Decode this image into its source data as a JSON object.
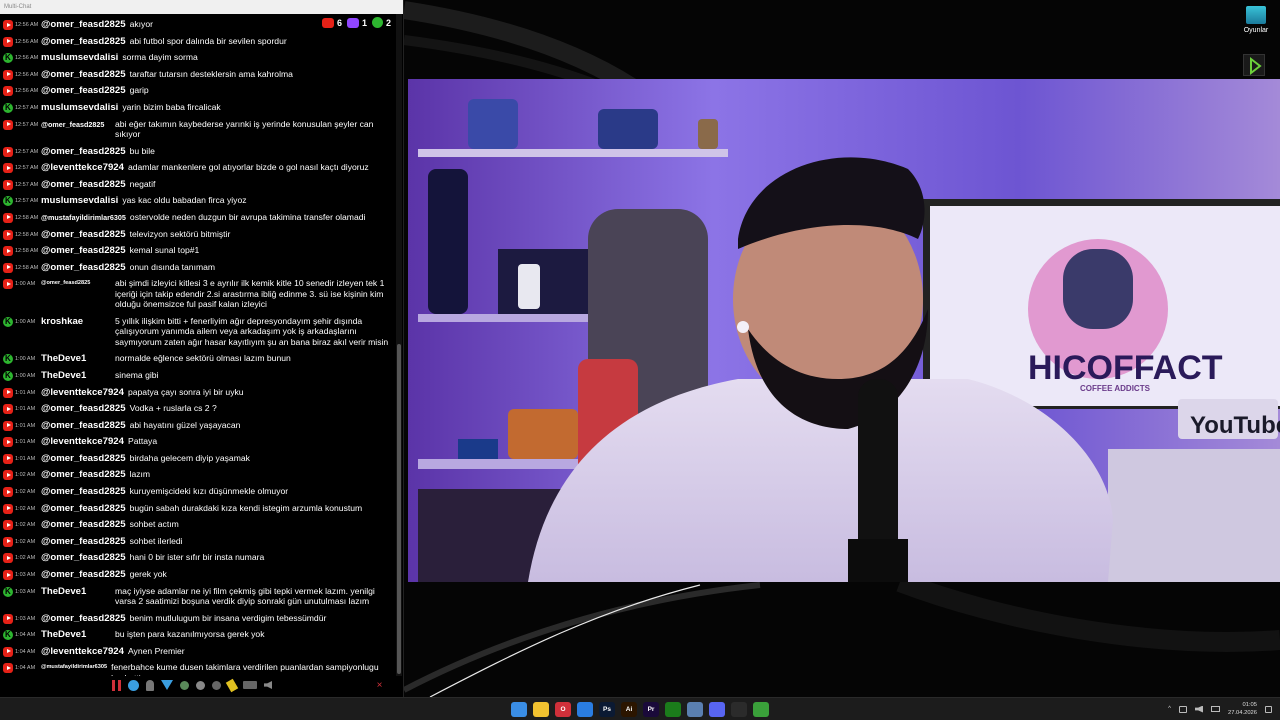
{
  "chat": {
    "title": "Multi-Chat",
    "counts": {
      "youtube": "6",
      "twitch": "1",
      "kick": "2"
    },
    "messages": [
      {
        "p": "yt",
        "time": "12:56 AM",
        "user": "@omer_feasd2825",
        "text": "akıyor"
      },
      {
        "p": "yt",
        "time": "12:56 AM",
        "user": "@omer_feasd2825",
        "text": "abi futbol spor dalında bir sevilen spordur"
      },
      {
        "p": "kk",
        "time": "12:56 AM",
        "user": "muslumsevdalisi",
        "text": "sorma dayim sorma"
      },
      {
        "p": "yt",
        "time": "12:56 AM",
        "user": "@omer_feasd2825",
        "text": "taraftar tutarsın desteklersin ama kahrolma"
      },
      {
        "p": "yt",
        "time": "12:56 AM",
        "user": "@omer_feasd2825",
        "text": "garip"
      },
      {
        "p": "kk",
        "time": "12:57 AM",
        "user": "muslumsevdalisi",
        "text": "yarin bizim baba fircalicak"
      },
      {
        "p": "yt",
        "time": "12:57 AM",
        "user": "@omer_feasd2825",
        "size": "sm",
        "fix": true,
        "text": "abi eğer takımın kaybederse yarınki iş yerinde konusulan şeyler can sıkıyor"
      },
      {
        "p": "yt",
        "time": "12:57 AM",
        "user": "@omer_feasd2825",
        "text": "bu bile"
      },
      {
        "p": "yt",
        "time": "12:57 AM",
        "user": "@leventtekce7924",
        "text": "adamlar mankenlere gol atıyorlar bizde o gol nasıl kaçtı diyoruz"
      },
      {
        "p": "yt",
        "time": "12:57 AM",
        "user": "@omer_feasd2825",
        "text": "negatif"
      },
      {
        "p": "kk",
        "time": "12:57 AM",
        "user": "muslumsevdalisi",
        "text": "yas kac oldu babadan firca yiyoz"
      },
      {
        "p": "yt",
        "time": "12:58 AM",
        "user": "@mustafayildirimlar6305",
        "size": "sm",
        "text": "ostervolde neden duzgun bir avrupa takimina transfer olamadi"
      },
      {
        "p": "yt",
        "time": "12:58 AM",
        "user": "@omer_feasd2825",
        "text": "televizyon sektörü bitmiştir"
      },
      {
        "p": "yt",
        "time": "12:58 AM",
        "user": "@omer_feasd2825",
        "text": "kemal sunal top#1"
      },
      {
        "p": "yt",
        "time": "12:58 AM",
        "user": "@omer_feasd2825",
        "text": "onun dısında tanımam"
      },
      {
        "p": "yt",
        "time": "1:00 AM",
        "user": "@omer_feasd2825",
        "size": "xs",
        "fix": true,
        "text": "abi şimdi izleyici kitlesi 3 e ayrılır ilk kemik kitle 10 senedir izleyen tek 1 içeriği için takip edendir 2.si arastırma ibliğ edinme 3. sü ise kişinin kim olduğu önemsizce ful pasif kalan izleyici"
      },
      {
        "p": "kk",
        "time": "1:00 AM",
        "user": "kroshkae",
        "fix": true,
        "text": "5 yıllık ilişkim bitti + fenerliyim ağır depresyondayım şehir dışında çalışıyorum yanımda ailem veya arkadaşım yok iş arkadaşlarını saymıyorum zaten ağır hasar kayıtlıyım şu an bana biraz akıl verir misin"
      },
      {
        "p": "kk",
        "time": "1:00 AM",
        "user": "TheDeve1",
        "fix": true,
        "text": "normalde eğlence sektörü olması lazım bunun"
      },
      {
        "p": "kk",
        "time": "1:00 AM",
        "user": "TheDeve1",
        "fix": true,
        "text": "sinema gibi"
      },
      {
        "p": "yt",
        "time": "1:01 AM",
        "user": "@leventtekce7924",
        "text": "papatya çayı sonra iyi bir uyku"
      },
      {
        "p": "yt",
        "time": "1:01 AM",
        "user": "@omer_feasd2825",
        "text": "Vodka + ruslarla cs 2 ?"
      },
      {
        "p": "yt",
        "time": "1:01 AM",
        "user": "@omer_feasd2825",
        "text": "abi hayatını güzel yaşayacan"
      },
      {
        "p": "yt",
        "time": "1:01 AM",
        "user": "@leventtekce7924",
        "text": "Pattaya"
      },
      {
        "p": "yt",
        "time": "1:01 AM",
        "user": "@omer_feasd2825",
        "text": "birdaha gelecem diyip yaşamak"
      },
      {
        "p": "yt",
        "time": "1:02 AM",
        "user": "@omer_feasd2825",
        "text": "lazım"
      },
      {
        "p": "yt",
        "time": "1:02 AM",
        "user": "@omer_feasd2825",
        "text": "kuruyemişcideki kızı düşünmekle olmuyor"
      },
      {
        "p": "yt",
        "time": "1:02 AM",
        "user": "@omer_feasd2825",
        "text": "bugün sabah durakdaki kıza kendi istegim arzumla konustum"
      },
      {
        "p": "yt",
        "time": "1:02 AM",
        "user": "@omer_feasd2825",
        "text": "sohbet actım"
      },
      {
        "p": "yt",
        "time": "1:02 AM",
        "user": "@omer_feasd2825",
        "text": "sohbet ilerledi"
      },
      {
        "p": "yt",
        "time": "1:02 AM",
        "user": "@omer_feasd2825",
        "text": "hani 0 bir ister sıfır bir insta numara"
      },
      {
        "p": "yt",
        "time": "1:03 AM",
        "user": "@omer_feasd2825",
        "text": "gerek yok"
      },
      {
        "p": "kk",
        "time": "1:03 AM",
        "user": "TheDeve1",
        "fix": true,
        "text": "maç iyiyse adamlar ne iyi film çekmiş gibi tepki vermek lazım. yenilgi varsa 2 saatimizi boşuna verdik diyip sonraki gün unutulması lazım"
      },
      {
        "p": "yt",
        "time": "1:03 AM",
        "user": "@omer_feasd2825",
        "text": "benim mutlulugum bir insana verdigim tebessümdür"
      },
      {
        "p": "kk",
        "time": "1:04 AM",
        "user": "TheDeve1",
        "fix": true,
        "text": "bu işten para kazanılmıyorsa gerek yok"
      },
      {
        "p": "yt",
        "time": "1:04 AM",
        "user": "@leventtekce7924",
        "text": "Aynen Premier"
      },
      {
        "p": "yt",
        "time": "1:04 AM",
        "user": "@mustafayildirimlar6305",
        "size": "xs",
        "text": "fenerbahce kume dusen takimlara verdirilen puanlardan sampiyonlugu kaybetti"
      }
    ]
  },
  "desktop": {
    "icon_games_label": "Oyunlar"
  },
  "video": {
    "banner_text": "HICOFFACT",
    "banner_sub": "COFFEE ADDICTS",
    "youtube_text": "YouTube"
  },
  "taskbar": {
    "apps": [
      {
        "name": "start",
        "label": "",
        "color": "#3a8ee6"
      },
      {
        "name": "files",
        "label": "",
        "color": "#f2c230"
      },
      {
        "name": "opera",
        "label": "O",
        "color": "#d0303a"
      },
      {
        "name": "app4",
        "label": "",
        "color": "#2a7de1"
      },
      {
        "name": "photoshop",
        "label": "Ps",
        "color": "#0b1a33"
      },
      {
        "name": "illustrator",
        "label": "Ai",
        "color": "#2b1500"
      },
      {
        "name": "premiere",
        "label": "Pr",
        "color": "#1a0a3a"
      },
      {
        "name": "xbox",
        "label": "",
        "color": "#1b7c1b"
      },
      {
        "name": "app9",
        "label": "",
        "color": "#5a7fb0"
      },
      {
        "name": "discord",
        "label": "",
        "color": "#5865f2"
      },
      {
        "name": "obs",
        "label": "",
        "color": "#2b2b2b"
      },
      {
        "name": "chat",
        "label": "",
        "color": "#3aa03a"
      }
    ],
    "clock_time": "01:05",
    "clock_date": "27.04.2026"
  },
  "colors": {
    "youtube": "#e62117",
    "kick": "#2db52f",
    "twitch": "#9146ff"
  }
}
